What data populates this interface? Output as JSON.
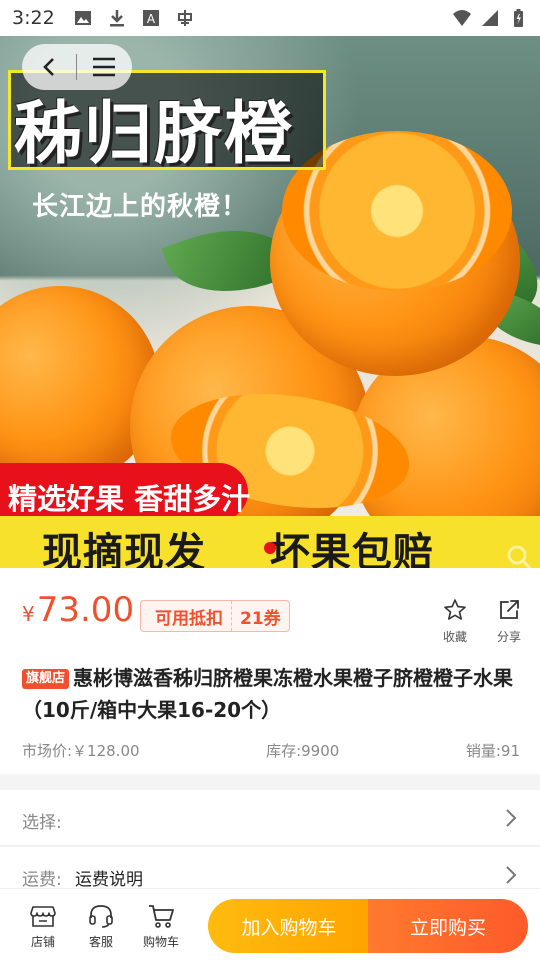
{
  "status_bar": {
    "time": "3:22",
    "left_icons": [
      "image-icon",
      "download-icon",
      "font-a-icon",
      "app-badge-icon"
    ],
    "right_icons": [
      "wifi-icon",
      "signal-icon",
      "battery-icon"
    ]
  },
  "hero": {
    "title": "秭归脐橙",
    "subtitle": "长江边上的秋橙！",
    "banner_red": "精选好果 香甜多汁",
    "banner_yellow_left": "现摘现发",
    "banner_yellow_right": "坏果包赔",
    "colors": {
      "banner_red": "#e8101a",
      "banner_yellow": "#f7e12a",
      "title_border": "#f5e628"
    }
  },
  "product": {
    "currency_symbol": "¥",
    "price": "73.00",
    "coupon_label": "可用抵扣",
    "coupon_value": "21券",
    "favorite_label": "收藏",
    "share_label": "分享",
    "store_tag": "旗舰店",
    "title": "惠彬博滋香秭归脐橙果冻橙水果橙子脐橙橙子水果（10斤/箱中大果16-20个）",
    "market_price": "市场价:￥128.00",
    "stock": "库存:9900",
    "sales": "销量:91",
    "accent_color": "#f0502e"
  },
  "options": {
    "select_label": "选择:",
    "shipping_label": "运费:",
    "shipping_value": "运费说明"
  },
  "bottom_bar": {
    "store_label": "店铺",
    "service_label": "客服",
    "cart_label": "购物车",
    "add_to_cart": "加入购物车",
    "buy_now": "立即购买"
  }
}
